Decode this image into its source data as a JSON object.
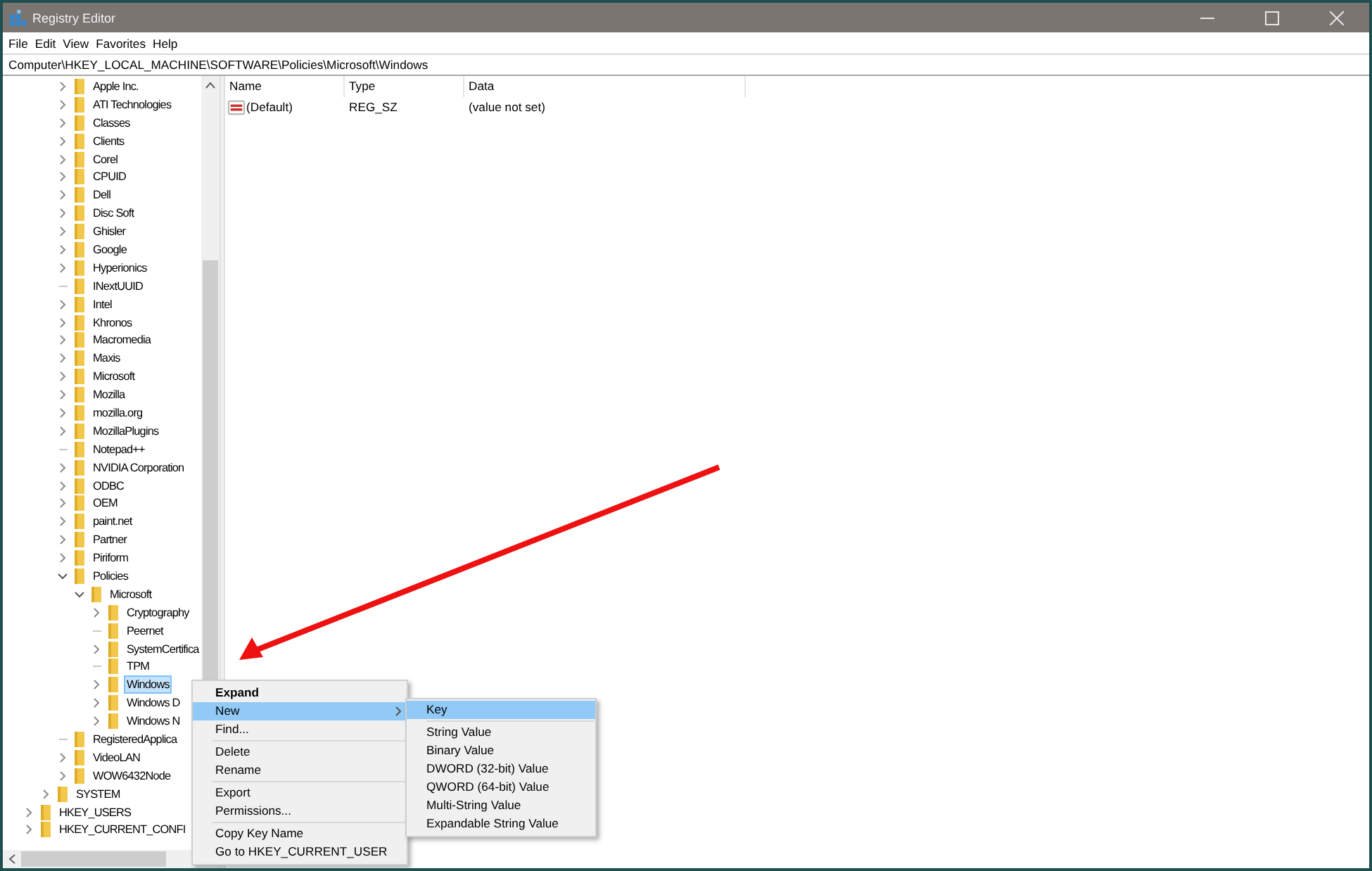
{
  "window": {
    "title": "Registry Editor"
  },
  "menu_bar": [
    "File",
    "Edit",
    "View",
    "Favorites",
    "Help"
  ],
  "address": "Computer\\HKEY_LOCAL_MACHINE\\SOFTWARE\\Policies\\Microsoft\\Windows",
  "tree": [
    {
      "children": [
        {
          "children": [
            {
              "children": [
                {
                  "label": "Apple Inc.",
                  "kind": "branch",
                  "expanded": false,
                  "selected": false
                },
                {
                  "label": "ATI Technologies",
                  "kind": "branch",
                  "expanded": false,
                  "selected": false
                },
                {
                  "label": "Classes",
                  "kind": "branch",
                  "expanded": false,
                  "selected": false
                },
                {
                  "label": "Clients",
                  "kind": "branch",
                  "expanded": false,
                  "selected": false
                },
                {
                  "label": "Corel",
                  "kind": "branch",
                  "expanded": false,
                  "selected": false
                },
                {
                  "label": "CPUID",
                  "kind": "branch",
                  "expanded": false,
                  "selected": false
                },
                {
                  "label": "Dell",
                  "kind": "branch",
                  "expanded": false,
                  "selected": false
                },
                {
                  "label": "Disc Soft",
                  "kind": "branch",
                  "expanded": false,
                  "selected": false
                },
                {
                  "label": "Ghisler",
                  "kind": "branch",
                  "expanded": false,
                  "selected": false
                },
                {
                  "label": "Google",
                  "kind": "branch",
                  "expanded": false,
                  "selected": false
                },
                {
                  "label": "Hyperionics",
                  "kind": "branch",
                  "expanded": false,
                  "selected": false
                },
                {
                  "label": "INextUUID",
                  "kind": "leaf",
                  "selected": false
                },
                {
                  "label": "Intel",
                  "kind": "branch",
                  "expanded": false,
                  "selected": false
                },
                {
                  "label": "Khronos",
                  "kind": "branch",
                  "expanded": false,
                  "selected": false
                },
                {
                  "label": "Macromedia",
                  "kind": "branch",
                  "expanded": false,
                  "selected": false
                },
                {
                  "label": "Maxis",
                  "kind": "branch",
                  "expanded": false,
                  "selected": false
                },
                {
                  "label": "Microsoft",
                  "kind": "branch",
                  "expanded": false,
                  "selected": false
                },
                {
                  "label": "Mozilla",
                  "kind": "branch",
                  "expanded": false,
                  "selected": false
                },
                {
                  "label": "mozilla.org",
                  "kind": "branch",
                  "expanded": false,
                  "selected": false
                },
                {
                  "label": "MozillaPlugins",
                  "kind": "branch",
                  "expanded": false,
                  "selected": false
                },
                {
                  "label": "Notepad++",
                  "kind": "leaf",
                  "selected": false
                },
                {
                  "label": "NVIDIA Corporation",
                  "kind": "branch",
                  "expanded": false,
                  "selected": false
                },
                {
                  "label": "ODBC",
                  "kind": "branch",
                  "expanded": false,
                  "selected": false
                },
                {
                  "label": "OEM",
                  "kind": "branch",
                  "expanded": false,
                  "selected": false
                },
                {
                  "label": "paint.net",
                  "kind": "branch",
                  "expanded": false,
                  "selected": false
                },
                {
                  "label": "Partner",
                  "kind": "branch",
                  "expanded": false,
                  "selected": false
                },
                {
                  "label": "Piriform",
                  "kind": "branch",
                  "expanded": false,
                  "selected": false
                },
                {
                  "label": "Policies",
                  "kind": "branch",
                  "expanded": true,
                  "selected": false,
                  "children": [
                    {
                      "label": "Microsoft",
                      "kind": "branch",
                      "expanded": true,
                      "selected": false,
                      "children": [
                        {
                          "label": "Cryptography",
                          "kind": "branch",
                          "expanded": false,
                          "selected": false
                        },
                        {
                          "label": "Peernet",
                          "kind": "leaf",
                          "selected": false
                        },
                        {
                          "label": "SystemCertifica",
                          "kind": "branch",
                          "expanded": false,
                          "selected": false
                        },
                        {
                          "label": "TPM",
                          "kind": "leaf",
                          "selected": false
                        },
                        {
                          "label": "Windows",
                          "kind": "branch",
                          "expanded": false,
                          "selected": true
                        },
                        {
                          "label": "Windows D",
                          "kind": "branch",
                          "expanded": false,
                          "selected": false
                        },
                        {
                          "label": "Windows N",
                          "kind": "branch",
                          "expanded": false,
                          "selected": false
                        }
                      ]
                    }
                  ]
                },
                {
                  "label": "RegisteredApplica",
                  "kind": "leaf",
                  "selected": false
                },
                {
                  "label": "VideoLAN",
                  "kind": "branch",
                  "expanded": false,
                  "selected": false
                },
                {
                  "label": "WOW6432Node",
                  "kind": "branch",
                  "expanded": false,
                  "selected": false
                }
              ]
            },
            {
              "label": "SYSTEM",
              "kind": "branch",
              "expanded": false,
              "selected": false
            }
          ]
        },
        {
          "label": "HKEY_USERS",
          "kind": "branch",
          "expanded": false,
          "selected": false
        },
        {
          "label": "HKEY_CURRENT_CONFI",
          "kind": "branch",
          "expanded": false,
          "selected": false
        }
      ]
    }
  ],
  "list": {
    "columns": [
      "Name",
      "Type",
      "Data"
    ],
    "rows": [
      {
        "name": "(Default)",
        "type": "REG_SZ",
        "data": "(value not set)"
      }
    ]
  },
  "context_menu": {
    "groups": [
      [
        {
          "label": "Expand",
          "default": true,
          "selected": false,
          "submenu": false
        },
        {
          "label": "New",
          "default": false,
          "selected": true,
          "submenu": true
        },
        {
          "label": "Find...",
          "default": false,
          "selected": false,
          "submenu": false
        }
      ],
      [
        {
          "label": "Delete",
          "default": false,
          "selected": false,
          "submenu": false
        },
        {
          "label": "Rename",
          "default": false,
          "selected": false,
          "submenu": false
        }
      ],
      [
        {
          "label": "Export",
          "default": false,
          "selected": false,
          "submenu": false
        },
        {
          "label": "Permissions...",
          "default": false,
          "selected": false,
          "submenu": false
        }
      ],
      [
        {
          "label": "Copy Key Name",
          "default": false,
          "selected": false,
          "submenu": false
        },
        {
          "label": "Go to HKEY_CURRENT_USER",
          "default": false,
          "selected": false,
          "submenu": false
        }
      ]
    ]
  },
  "submenu": {
    "groups": [
      [
        {
          "label": "Key",
          "selected": true
        }
      ],
      [
        {
          "label": "String Value",
          "selected": false
        },
        {
          "label": "Binary Value",
          "selected": false
        },
        {
          "label": "DWORD (32-bit) Value",
          "selected": false
        },
        {
          "label": "QWORD (64-bit) Value",
          "selected": false
        },
        {
          "label": "Multi-String Value",
          "selected": false
        },
        {
          "label": "Expandable String Value",
          "selected": false
        }
      ]
    ]
  }
}
